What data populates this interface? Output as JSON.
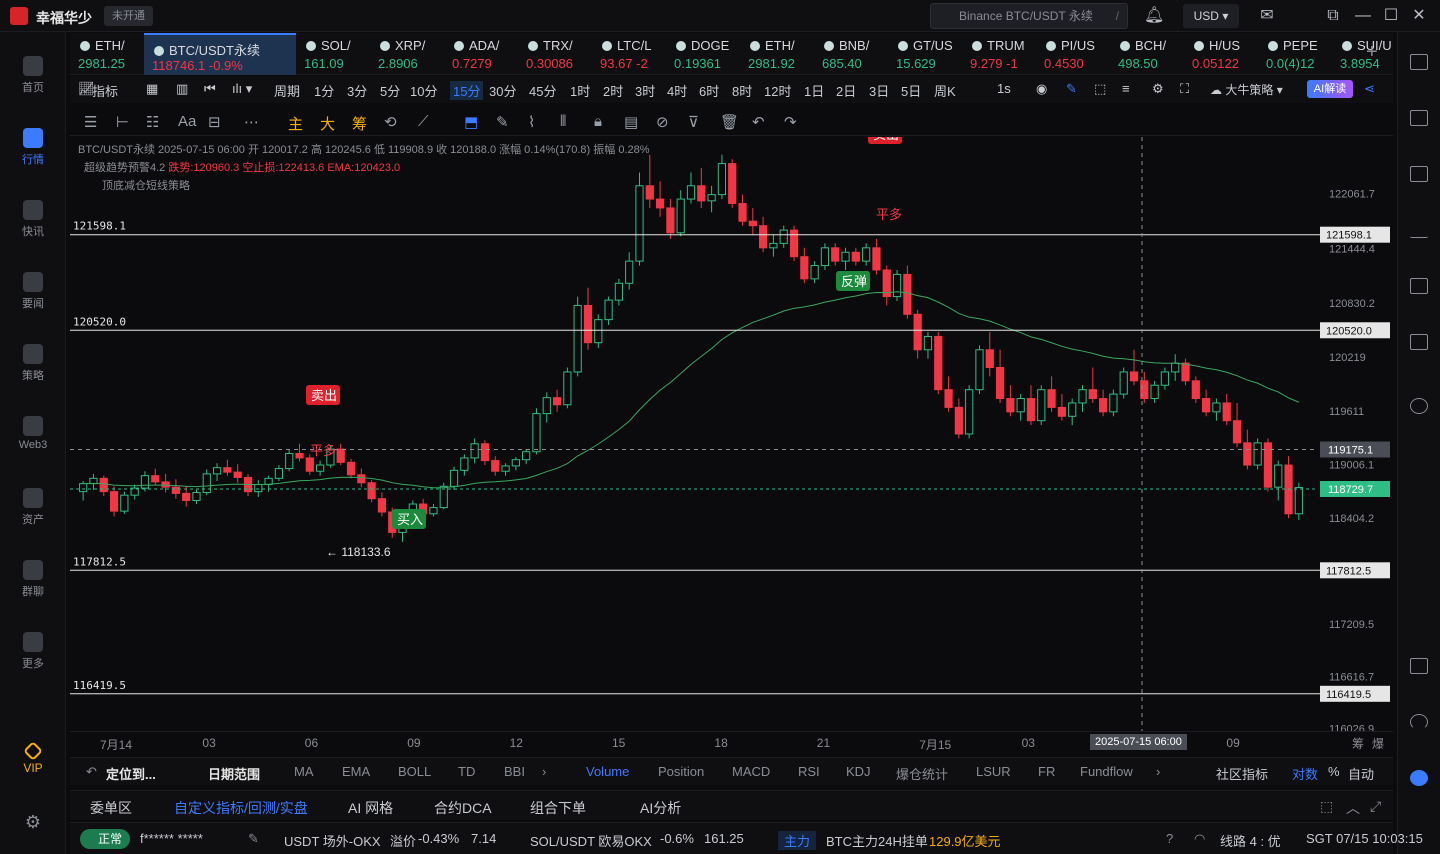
{
  "app": {
    "title": "幸福华少",
    "badge": "未开通"
  },
  "titlebar": {
    "search_placeholder": "Binance BTC/USDT 永续",
    "search_shortcut": "/",
    "currency": "USD"
  },
  "sidebar": {
    "items": [
      {
        "label": "首页",
        "icon": "home-icon"
      },
      {
        "label": "行情",
        "icon": "market-icon",
        "active": true
      },
      {
        "label": "快讯",
        "icon": "news-icon"
      },
      {
        "label": "要闻",
        "icon": "headline-icon"
      },
      {
        "label": "策略",
        "icon": "strategy-icon"
      },
      {
        "label": "Web3",
        "icon": "web3-icon"
      },
      {
        "label": "资产",
        "icon": "wallet-icon"
      },
      {
        "label": "群聊",
        "icon": "chat-icon"
      },
      {
        "label": "更多",
        "icon": "more-icon"
      }
    ],
    "vip": "VIP"
  },
  "tickers": [
    {
      "name": "ETH/​",
      "price": "2981.25",
      "dir": "up"
    },
    {
      "name": "BTC/USDT永续",
      "price": "118746.1  -0.9%",
      "dir": "dn",
      "active": true
    },
    {
      "name": "SOL/​",
      "price": "161.09",
      "dir": "up"
    },
    {
      "name": "XRP/​",
      "price": "2.8906",
      "dir": "up"
    },
    {
      "name": "ADA/",
      "price": "0.7279",
      "dir": "dn"
    },
    {
      "name": "TRX/​",
      "price": "0.30086",
      "dir": "dn"
    },
    {
      "name": "LTC/L",
      "price": "93.67  -2",
      "dir": "dn"
    },
    {
      "name": "DOGE",
      "price": "0.19361",
      "dir": "up"
    },
    {
      "name": "ETH/​",
      "price": "2981.92",
      "dir": "up"
    },
    {
      "name": "BNB/",
      "price": "685.40",
      "dir": "up"
    },
    {
      "name": "GT/US",
      "price": "15.629",
      "dir": "up"
    },
    {
      "name": "TRUM",
      "price": "9.279  -1",
      "dir": "dn"
    },
    {
      "name": "PI/US",
      "price": "0.4530",
      "dir": "dn"
    },
    {
      "name": "BCH/",
      "price": "498.50",
      "dir": "up"
    },
    {
      "name": "H/US",
      "price": "0.05122",
      "dir": "dn"
    },
    {
      "name": "PEPE",
      "price": "0.0(4)12",
      "dir": "up"
    },
    {
      "name": "SUI/U",
      "price": "3.8954",
      "dir": "up"
    }
  ],
  "periods": {
    "labels": [
      "指标",
      "周期",
      "1分",
      "3分",
      "5分",
      "10分",
      "15分",
      "30分",
      "45分",
      "1时",
      "2时",
      "3时",
      "4时",
      "6时",
      "8时",
      "12时",
      "1日",
      "2日",
      "3日",
      "5日",
      "周K",
      "1s"
    ],
    "active": "15分",
    "strategy": "大牛策略",
    "ai_button": "AI解读"
  },
  "drawing_tools": {
    "labels": [
      "Aa",
      "主",
      "大",
      "筹"
    ]
  },
  "legend": {
    "line1": "BTC/USDT永续  2025-07-15 06:00  开 120017.2  高 120245.6  低 119908.9  收 120188.0  涨幅 0.14%(170.8)  振幅 0.28%",
    "line2_label": "超级趋势预警4.2",
    "line2_values": "跌势:120960.3  空止损:122413.6  EMA:120423.0",
    "line3": "顶底减仓短线策略"
  },
  "chart_data": {
    "type": "candlestick",
    "symbol": "BTC/USDT永续",
    "interval": "15分",
    "ylim": [
      116000,
      122700
    ],
    "y_ticks": [
      122061.7,
      121444.4,
      120830.2,
      120219.0,
      119611.0,
      119006.1,
      118404.2,
      117209.5,
      116616.7,
      116026.9
    ],
    "x_ticks": [
      "7月14",
      "03",
      "06",
      "09",
      "12",
      "15",
      "18",
      "21",
      "7月15",
      "03",
      "06",
      "09"
    ],
    "crosshair_time": "2025-07-15 06:00",
    "crosshair_price": "119175.1",
    "last_price": "118729.7",
    "horizontal_levels": [
      {
        "value": 121598.1,
        "label": "121598.1"
      },
      {
        "value": 120520.0,
        "label": "120520.0"
      },
      {
        "value": 117812.5,
        "label": "117812.5"
      },
      {
        "value": 116419.5,
        "label": "116419.5"
      }
    ],
    "low_marker": "118133.6",
    "signals": [
      {
        "label": "卖出",
        "kind": "sell"
      },
      {
        "label": "平多",
        "kind": "close"
      },
      {
        "label": "买入",
        "kind": "buy"
      },
      {
        "label": "卖出",
        "kind": "sell"
      },
      {
        "label": "平多",
        "kind": "close"
      },
      {
        "label": "反弹",
        "kind": "buy"
      }
    ],
    "candles": [
      [
        118700,
        118820,
        118600,
        118790
      ],
      [
        118790,
        118900,
        118720,
        118850
      ],
      [
        118850,
        118880,
        118650,
        118700
      ],
      [
        118700,
        118760,
        118420,
        118480
      ],
      [
        118480,
        118700,
        118450,
        118660
      ],
      [
        118660,
        118780,
        118610,
        118740
      ],
      [
        118740,
        118930,
        118700,
        118880
      ],
      [
        118880,
        118960,
        118780,
        118810
      ],
      [
        118810,
        118900,
        118690,
        118750
      ],
      [
        118750,
        118840,
        118620,
        118680
      ],
      [
        118680,
        118760,
        118530,
        118600
      ],
      [
        118600,
        118720,
        118560,
        118690
      ],
      [
        118690,
        118950,
        118660,
        118900
      ],
      [
        118900,
        119020,
        118820,
        118970
      ],
      [
        118970,
        119060,
        118880,
        118920
      ],
      [
        118920,
        119010,
        118800,
        118860
      ],
      [
        118860,
        118900,
        118650,
        118700
      ],
      [
        118700,
        118830,
        118640,
        118780
      ],
      [
        118780,
        118880,
        118700,
        118850
      ],
      [
        118850,
        119000,
        118820,
        118960
      ],
      [
        118960,
        119180,
        118930,
        119130
      ],
      [
        119130,
        119240,
        119040,
        119080
      ],
      [
        119080,
        119120,
        118890,
        118930
      ],
      [
        118930,
        119050,
        118880,
        119000
      ],
      [
        119000,
        119220,
        118970,
        119180
      ],
      [
        119180,
        119240,
        119000,
        119030
      ],
      [
        119030,
        119070,
        118850,
        118890
      ],
      [
        118890,
        118960,
        118750,
        118800
      ],
      [
        118800,
        118830,
        118580,
        118620
      ],
      [
        118620,
        118690,
        118420,
        118470
      ],
      [
        118470,
        118520,
        118180,
        118240
      ],
      [
        118240,
        118470,
        118133,
        118420
      ],
      [
        118420,
        118600,
        118380,
        118560
      ],
      [
        118560,
        118620,
        118400,
        118450
      ],
      [
        118450,
        118560,
        118420,
        118520
      ],
      [
        118520,
        118800,
        118500,
        118760
      ],
      [
        118760,
        118980,
        118720,
        118940
      ],
      [
        118940,
        119120,
        118880,
        119080
      ],
      [
        119080,
        119300,
        119020,
        119240
      ],
      [
        119240,
        119280,
        119000,
        119050
      ],
      [
        119050,
        119100,
        118880,
        118930
      ],
      [
        118930,
        119020,
        118880,
        118990
      ],
      [
        118990,
        119090,
        118940,
        119060
      ],
      [
        119060,
        119180,
        119010,
        119150
      ],
      [
        119150,
        119640,
        119120,
        119580
      ],
      [
        119580,
        119820,
        119480,
        119760
      ],
      [
        119760,
        119850,
        119600,
        119680
      ],
      [
        119680,
        120100,
        119640,
        120050
      ],
      [
        120050,
        120900,
        120000,
        120800
      ],
      [
        120800,
        121000,
        120300,
        120380
      ],
      [
        120380,
        120700,
        120320,
        120640
      ],
      [
        120640,
        120900,
        120580,
        120860
      ],
      [
        120860,
        121100,
        120800,
        121050
      ],
      [
        121050,
        121400,
        120980,
        121300
      ],
      [
        121300,
        122300,
        121250,
        122150
      ],
      [
        122150,
        122500,
        121900,
        122000
      ],
      [
        122000,
        122200,
        121800,
        121900
      ],
      [
        121900,
        122000,
        121550,
        121620
      ],
      [
        121620,
        122100,
        121580,
        122000
      ],
      [
        122000,
        122300,
        121950,
        122150
      ],
      [
        122150,
        122350,
        121900,
        121980
      ],
      [
        121980,
        122150,
        121850,
        122050
      ],
      [
        122050,
        122500,
        122000,
        122400
      ],
      [
        122400,
        122450,
        121900,
        121950
      ],
      [
        121950,
        122050,
        121700,
        121750
      ],
      [
        121750,
        121900,
        121600,
        121700
      ],
      [
        121700,
        121800,
        121400,
        121450
      ],
      [
        121450,
        121600,
        121350,
        121500
      ],
      [
        121500,
        121700,
        121450,
        121650
      ],
      [
        121650,
        121700,
        121300,
        121350
      ],
      [
        121350,
        121450,
        121050,
        121100
      ],
      [
        121100,
        121300,
        121050,
        121250
      ],
      [
        121250,
        121500,
        121200,
        121450
      ],
      [
        121450,
        121500,
        121250,
        121300
      ],
      [
        121300,
        121450,
        121200,
        121400
      ],
      [
        121400,
        121450,
        121250,
        121300
      ],
      [
        121300,
        121500,
        121250,
        121450
      ],
      [
        121450,
        121550,
        121150,
        121200
      ],
      [
        121200,
        121250,
        120800,
        120900
      ],
      [
        120900,
        121200,
        120850,
        121150
      ],
      [
        121150,
        121250,
        120650,
        120700
      ],
      [
        120700,
        120750,
        120200,
        120300
      ],
      [
        120300,
        120500,
        120200,
        120450
      ],
      [
        120450,
        120500,
        119800,
        119850
      ],
      [
        119850,
        120000,
        119600,
        119650
      ],
      [
        119650,
        119750,
        119300,
        119350
      ],
      [
        119350,
        119900,
        119300,
        119850
      ],
      [
        119850,
        120350,
        119800,
        120300
      ],
      [
        120300,
        120500,
        120000,
        120100
      ],
      [
        120100,
        120300,
        119700,
        119750
      ],
      [
        119750,
        119900,
        119550,
        119600
      ],
      [
        119600,
        119800,
        119500,
        119750
      ],
      [
        119750,
        119900,
        119450,
        119500
      ],
      [
        119500,
        119900,
        119450,
        119850
      ],
      [
        119850,
        120000,
        119600,
        119650
      ],
      [
        119650,
        119800,
        119500,
        119550
      ],
      [
        119550,
        119750,
        119450,
        119700
      ],
      [
        119700,
        119900,
        119600,
        119850
      ],
      [
        119850,
        120100,
        119700,
        119750
      ],
      [
        119750,
        119850,
        119550,
        119600
      ],
      [
        119600,
        119850,
        119550,
        119800
      ],
      [
        119800,
        120100,
        119750,
        120050
      ],
      [
        120050,
        120300,
        119900,
        119950
      ],
      [
        119950,
        120050,
        119700,
        119750
      ],
      [
        119750,
        119950,
        119700,
        119900
      ],
      [
        119900,
        120100,
        119850,
        120050
      ],
      [
        120050,
        120250,
        119950,
        120150
      ],
      [
        120150,
        120200,
        119900,
        119950
      ],
      [
        119950,
        120000,
        119700,
        119750
      ],
      [
        119750,
        119850,
        119550,
        119600
      ],
      [
        119600,
        119750,
        119500,
        119700
      ],
      [
        119700,
        119800,
        119450,
        119500
      ],
      [
        119500,
        119700,
        119200,
        119250
      ],
      [
        119250,
        119400,
        118950,
        119000
      ],
      [
        119000,
        119300,
        118950,
        119250
      ],
      [
        119250,
        119300,
        118700,
        118750
      ],
      [
        118750,
        119050,
        118600,
        119000
      ],
      [
        119000,
        119100,
        118400,
        118450
      ],
      [
        118450,
        118800,
        118380,
        118746
      ]
    ]
  },
  "indicator_bar": {
    "left": [
      "定位到...",
      "日期范围"
    ],
    "tabs": [
      "MA",
      "EMA",
      "BOLL",
      "TD",
      "BBI",
      "Volume",
      "Position",
      "MACD",
      "RSI",
      "KDJ",
      "爆仓统计",
      "LSUR",
      "FR",
      "Fundflow"
    ],
    "active": "Volume",
    "right": [
      "社区指标",
      "对数",
      "%",
      "自动"
    ],
    "axis_right": [
      "筹",
      "爆"
    ]
  },
  "panel_tabs": {
    "items": [
      "委单区",
      "自定义指标/回测/实盘",
      "AI 网格",
      "合约DCA",
      "组合下单",
      "AI分析"
    ],
    "active": "自定义指标/回测/实盘"
  },
  "statusbar": {
    "status": "正常",
    "user": "f****** *****",
    "tick1_name": "USDT 场外-OKX",
    "tick1_label": "溢价",
    "tick1_pct": "-0.43%",
    "tick1_val": "7.14",
    "tick2_name": "SOL/USDT 欧易OKX",
    "tick2_pct": "-0.6%",
    "tick2_val": "161.25",
    "flow_badge": "主力",
    "flow_text": "BTC主力24H挂单",
    "flow_val": "129.9亿美元",
    "line": "线路 4 : 优",
    "clock": "SGT 07/15 10:03:15"
  },
  "colors": {
    "up": "#2ebd85",
    "down": "#f23645",
    "accent": "#3b7bff"
  }
}
